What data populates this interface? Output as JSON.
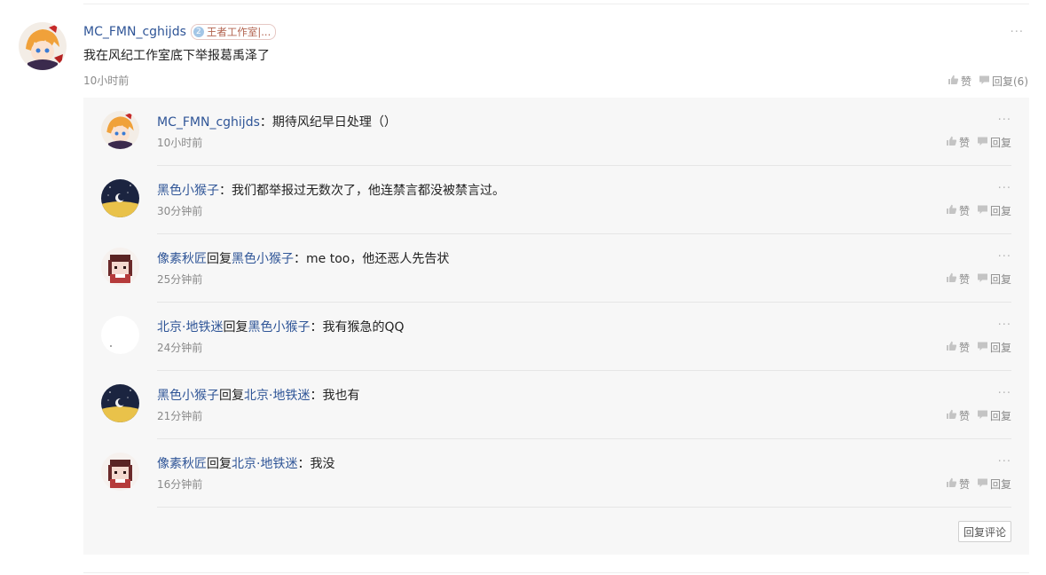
{
  "main_comment": {
    "username": "MC_FMN_cghijds",
    "badge": {
      "level": "2",
      "text": "王者工作室|..."
    },
    "text": "我在风纪工作室底下举报葛禹泽了",
    "time": "10小时前",
    "actions": {
      "like": "赞",
      "reply": "回复(6)"
    },
    "more": "···"
  },
  "replies": [
    {
      "user": "MC_FMN_cghijds",
      "reply_word": "",
      "target": "",
      "colon": "：",
      "text": "期待风纪早日处理（）",
      "time": "10小时前",
      "like": "赞",
      "reply": "回复",
      "more": "···",
      "avatar": "anime-avatar"
    },
    {
      "user": "黑色小猴子",
      "reply_word": "",
      "target": "",
      "colon": "：",
      "text": "我们都举报过无数次了，他连禁言都没被禁言过。",
      "time": "30分钟前",
      "like": "赞",
      "reply": "回复",
      "more": "···",
      "avatar": "moon-avatar"
    },
    {
      "user": "像素秋匠",
      "reply_word": "回复",
      "target": "黑色小猴子",
      "colon": "：",
      "text": "me too，他还恶人先告状",
      "time": "25分钟前",
      "like": "赞",
      "reply": "回复",
      "more": "···",
      "avatar": "pixel-avatar"
    },
    {
      "user": "北京·地铁迷",
      "reply_word": "回复",
      "target": "黑色小猴子",
      "colon": "：",
      "text": "我有猴急的QQ",
      "time": "24分钟前",
      "like": "赞",
      "reply": "回复",
      "more": "···",
      "avatar": "blank-avatar"
    },
    {
      "user": "黑色小猴子",
      "reply_word": "回复",
      "target": "北京·地铁迷",
      "colon": "：",
      "text": "我也有",
      "time": "21分钟前",
      "like": "赞",
      "reply": "回复",
      "more": "···",
      "avatar": "moon-avatar"
    },
    {
      "user": "像素秋匠",
      "reply_word": "回复",
      "target": "北京·地铁迷",
      "colon": "：",
      "text": "我没",
      "time": "16分钟前",
      "like": "赞",
      "reply": "回复",
      "more": "···",
      "avatar": "pixel-avatar"
    }
  ],
  "reply_comment_button": "回复评论",
  "colors": {
    "username": "#2f5597",
    "meta": "#8a8a8a",
    "panel_bg": "#f7f7f7"
  }
}
